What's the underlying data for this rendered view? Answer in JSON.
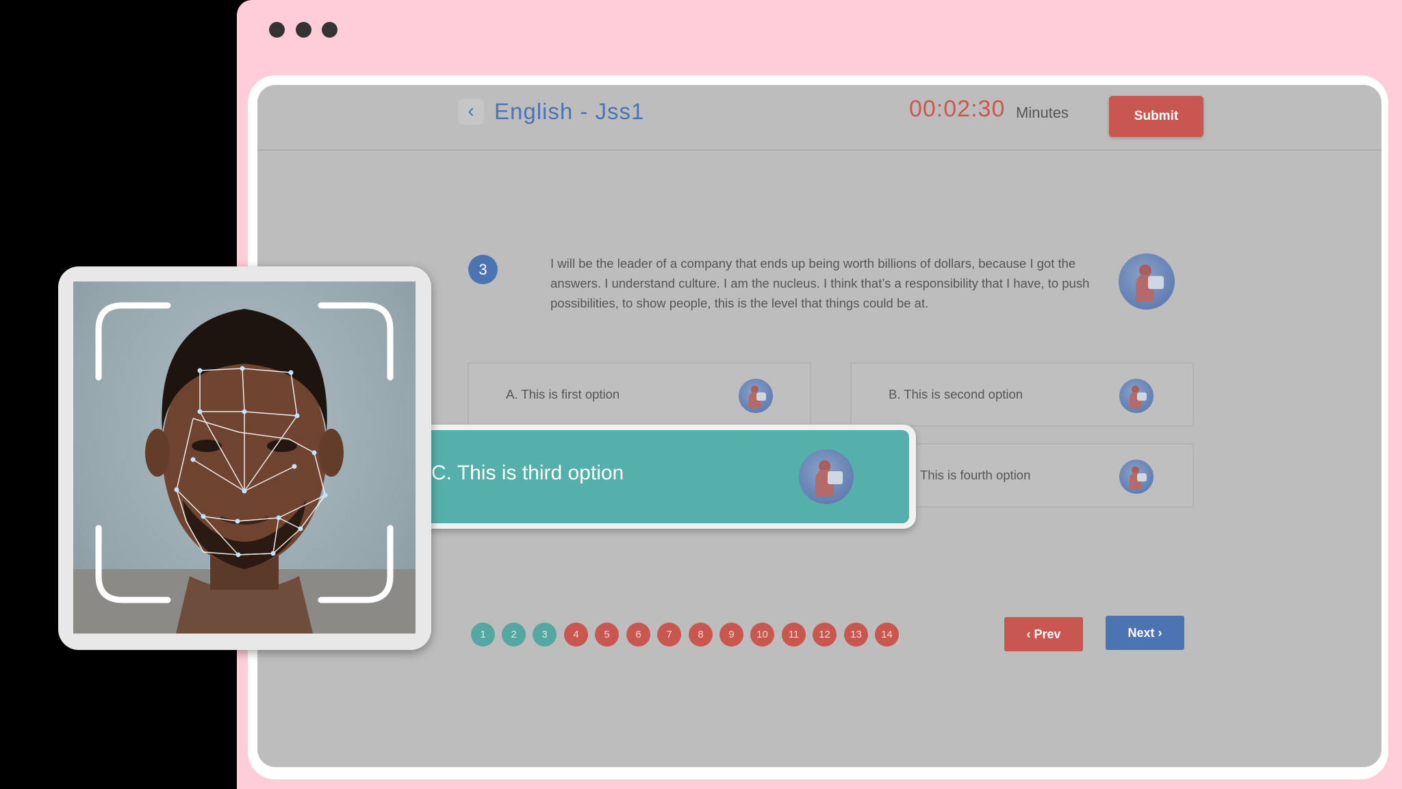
{
  "window": {
    "dots": [
      "dot",
      "dot",
      "dot"
    ]
  },
  "header": {
    "back_icon": "chevron-left-icon",
    "back_glyph": "‹",
    "title": "English - Jss1",
    "timer": "00:02:30",
    "timer_unit": "Minutes",
    "submit_label": "Submit"
  },
  "question": {
    "number": "3",
    "text": "I will be the leader of a company that ends up being worth billions of dollars, because I got the answers. I understand culture. I am the nucleus. I think that’s a responsibility that I have, to push possibilities, to show people, this is the level that things could be at."
  },
  "options": [
    {
      "label": "A. This is first option"
    },
    {
      "label": "B. This is second option"
    },
    {
      "label": "C. This is third option",
      "selected": true
    },
    {
      "label": ". This is fourth option"
    }
  ],
  "highlight": {
    "label": "C. This is third option"
  },
  "pagination": {
    "pages": [
      "1",
      "2",
      "3",
      "4",
      "5",
      "6",
      "7",
      "8",
      "9",
      "10",
      "11",
      "12",
      "13",
      "14"
    ],
    "answered_through": 3
  },
  "nav": {
    "prev_label": "‹ Prev",
    "next_label": "Next ›"
  },
  "colors": {
    "accent_blue": "#4c74b3",
    "accent_red": "#c8584f",
    "accent_teal": "#55b0ab",
    "browser_pink": "#ffcdd7"
  }
}
